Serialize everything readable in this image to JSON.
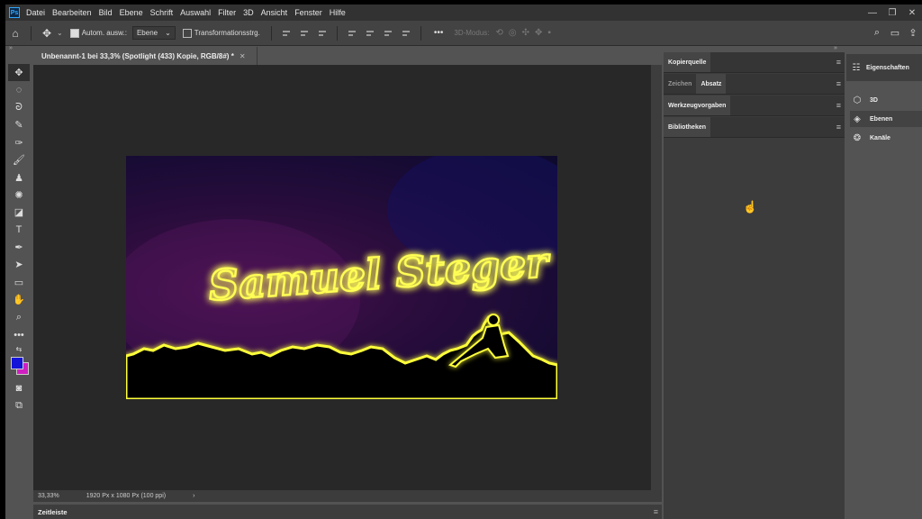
{
  "app": {
    "logo": "Ps"
  },
  "menubar": {
    "items": [
      "Datei",
      "Bearbeiten",
      "Bild",
      "Ebene",
      "Schrift",
      "Auswahl",
      "Filter",
      "3D",
      "Ansicht",
      "Fenster",
      "Hilfe"
    ],
    "window_controls": [
      "—",
      "❐",
      "✕"
    ]
  },
  "options": {
    "auto_select_label": "Autom. ausw.:",
    "auto_select_checked": true,
    "layer_dropdown": "Ebene",
    "transform_label": "Transformationsstrg.",
    "transform_checked": false,
    "mode_3d_label": "3D-Modus:",
    "more": "•••"
  },
  "document": {
    "tab_title": "Unbenannt-1 bei 33,3% (Spotlight (433) Kopie, RGB/8#) *",
    "artwork_text": "Samuel Steger",
    "status_zoom": "33,33%",
    "status_info": "1920 Px x 1080 Px (100 ppi)"
  },
  "colors": {
    "foreground": "#1414d8",
    "background": "#d020c0",
    "glow": "#ffff40"
  },
  "panels": {
    "group1": [
      "Kopierquelle"
    ],
    "group2": [
      "Zeichen",
      "Absatz"
    ],
    "group3": [
      "Werkzeugvorgaben"
    ],
    "group4": [
      "Bibliotheken"
    ]
  },
  "right_panels": {
    "header": "Eigenschaften",
    "items": [
      {
        "label": "3D",
        "icon": "cube-icon"
      },
      {
        "label": "Ebenen",
        "icon": "layers-icon"
      },
      {
        "label": "Kanäle",
        "icon": "channels-icon"
      }
    ]
  },
  "timeline": {
    "label": "Zeitleiste"
  }
}
